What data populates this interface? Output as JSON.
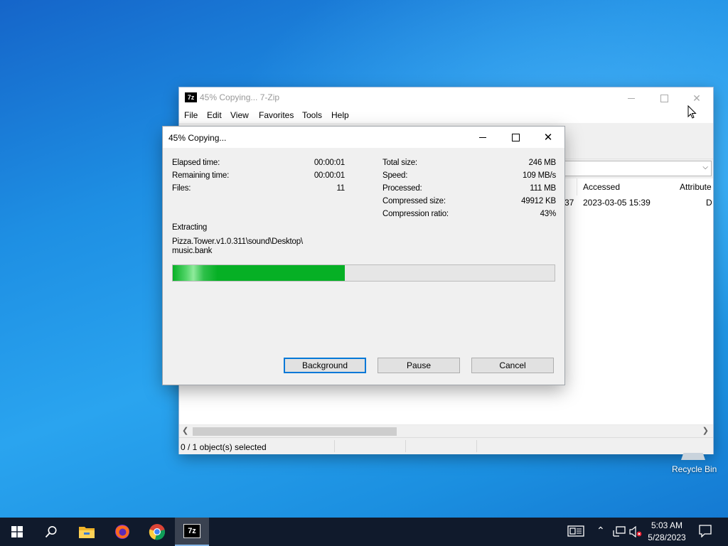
{
  "main_window": {
    "title": "45% Copying... 7-Zip",
    "app_icon": "7z",
    "menu": [
      "File",
      "Edit",
      "View",
      "Favorites",
      "Tools",
      "Help"
    ],
    "columns": [
      "Accessed",
      "Attribute"
    ],
    "row": {
      "partial_modified": "37",
      "accessed": "2023-03-05 15:39",
      "attribute": "D"
    },
    "status": "0 / 1 object(s) selected"
  },
  "dialog": {
    "title": "45% Copying...",
    "left_stats": [
      {
        "label": "Elapsed time:",
        "value": "00:00:01"
      },
      {
        "label": "Remaining time:",
        "value": "00:00:01"
      },
      {
        "label": "Files:",
        "value": "11"
      }
    ],
    "right_stats": [
      {
        "label": "Total size:",
        "value": "246 MB"
      },
      {
        "label": "Speed:",
        "value": "109 MB/s"
      },
      {
        "label": "Processed:",
        "value": "111 MB"
      },
      {
        "label": "Compressed size:",
        "value": "49912 KB"
      },
      {
        "label": "Compression ratio:",
        "value": "43%"
      }
    ],
    "operation": "Extracting",
    "file_path_line1": "Pizza.Tower.v1.0.311\\sound\\Desktop\\",
    "file_path_line2": "music.bank",
    "progress_fraction": 0.45,
    "buttons": {
      "background": "Background",
      "pause": "Pause",
      "cancel": "Cancel"
    }
  },
  "desktop": {
    "recycle_bin_label": "Recycle Bin"
  },
  "taskbar": {
    "time": "5:03 AM",
    "date": "5/28/2023",
    "apps": [
      "start-icon",
      "search-icon",
      "file-explorer-icon",
      "firefox-icon",
      "chrome-icon",
      "7zip-icon"
    ],
    "accent": "#86b7e8"
  }
}
